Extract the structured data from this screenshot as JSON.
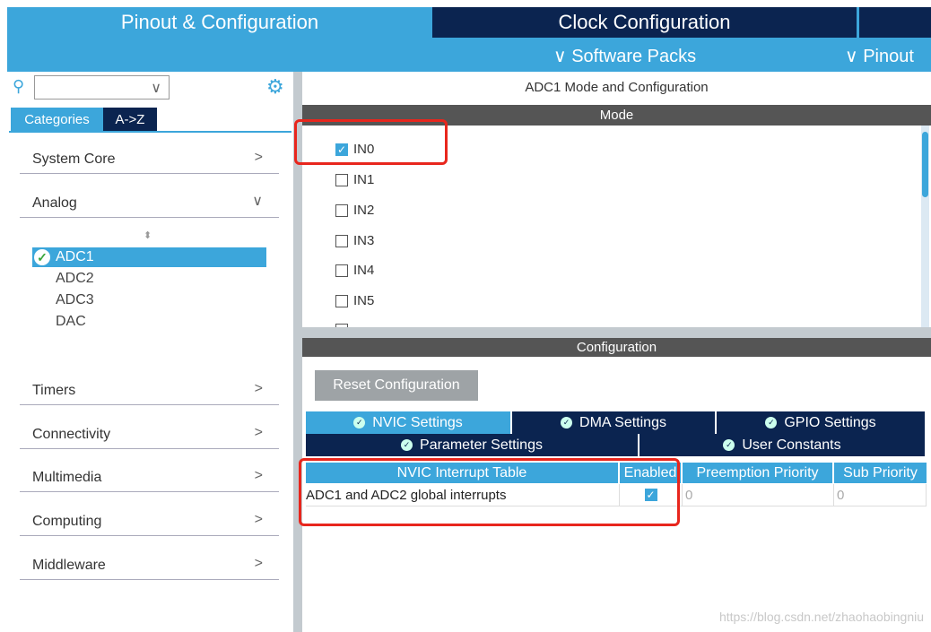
{
  "top_tabs": {
    "pinout": "Pinout & Configuration",
    "clock": "Clock Configuration"
  },
  "menu": {
    "software_packs": "Software Packs",
    "pinout": "Pinout",
    "chevron": "⌄"
  },
  "left": {
    "search_value": "",
    "tabs": [
      "Categories",
      "A->Z"
    ],
    "categories": [
      {
        "label": "System Core",
        "state": "collapsed"
      },
      {
        "label": "Analog",
        "state": "expanded"
      },
      {
        "label": "Timers",
        "state": "collapsed"
      },
      {
        "label": "Connectivity",
        "state": "collapsed"
      },
      {
        "label": "Multimedia",
        "state": "collapsed"
      },
      {
        "label": "Computing",
        "state": "collapsed"
      },
      {
        "label": "Middleware",
        "state": "collapsed"
      }
    ],
    "analog_items": [
      {
        "label": "ADC1",
        "selected": true,
        "configured": true
      },
      {
        "label": "ADC2"
      },
      {
        "label": "ADC3"
      },
      {
        "label": "DAC"
      }
    ]
  },
  "main": {
    "title": "ADC1 Mode and Configuration",
    "mode_header": "Mode",
    "mode_items": [
      {
        "label": "IN0",
        "checked": true
      },
      {
        "label": "IN1",
        "checked": false
      },
      {
        "label": "IN2",
        "checked": false
      },
      {
        "label": "IN3",
        "checked": false
      },
      {
        "label": "IN4",
        "checked": false
      },
      {
        "label": "IN5",
        "checked": false
      }
    ],
    "config_header": "Configuration",
    "reset_button": "Reset Configuration",
    "config_tabs": [
      "NVIC Settings",
      "DMA Settings",
      "GPIO Settings",
      "Parameter Settings",
      "User Constants"
    ],
    "table": {
      "headers": [
        "NVIC Interrupt Table",
        "Enabled",
        "Preemption Priority",
        "Sub Priority"
      ],
      "rows": [
        {
          "name": "ADC1 and ADC2 global interrupts",
          "enabled": true,
          "preemption": "0",
          "sub": "0"
        }
      ]
    }
  },
  "watermark": "https://blog.csdn.net/zhaohaobingniu",
  "colors": {
    "accent": "#3ca6db",
    "navy": "#0b2450",
    "header_gray": "#555555",
    "annotation_red": "#e8261d"
  }
}
